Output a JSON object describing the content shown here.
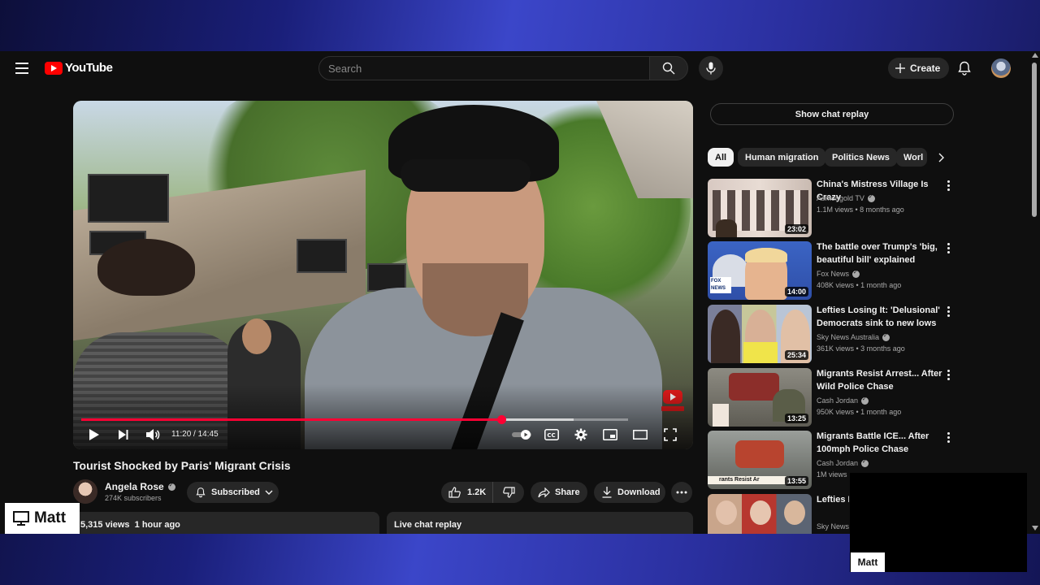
{
  "header": {
    "logo_text": "YouTube",
    "search_placeholder": "Search",
    "create_label": "Create"
  },
  "player": {
    "time_display": "11:20 / 14:45",
    "progress_fraction": 0.768,
    "loaded_fraction": 0.9
  },
  "video": {
    "title": "Tourist Shocked by Paris' Migrant Crisis",
    "channel_name": "Angela Rose",
    "subscribers": "274K subscribers",
    "subscribed_label": "Subscribed",
    "like_count": "1.2K",
    "share_label": "Share",
    "download_label": "Download",
    "views_time": "5,315 views  1 hour ago",
    "live_chat_replay": "Live chat replay"
  },
  "sidebar": {
    "show_chat_replay": "Show chat replay",
    "chips": [
      "All",
      "Human migration",
      "Politics News",
      "Worl"
    ],
    "recommendations": [
      {
        "title": "China's Mistress Village Is Crazy",
        "channel": "Asmongold TV",
        "verified": true,
        "meta": "1.1M views • 8 months ago",
        "duration": "23:02"
      },
      {
        "title": "The battle over Trump's 'big, beautiful bill' explained",
        "channel": "Fox News",
        "verified": true,
        "meta": "408K views • 1 month ago",
        "duration": "14:00"
      },
      {
        "title": "Lefties Losing It: 'Delusional' Democrats sink to new lows",
        "channel": "Sky News Australia",
        "verified": true,
        "meta": "361K views • 3 months ago",
        "duration": "25:34"
      },
      {
        "title": "Migrants Resist Arrest... After Wild Police Chase",
        "channel": "Cash Jordan",
        "verified": true,
        "meta": "950K views • 1 month ago",
        "duration": "13:25"
      },
      {
        "title": "Migrants Battle ICE... After 100mph Police Chase",
        "channel": "Cash Jordan",
        "verified": true,
        "meta": "1M views",
        "duration": "13:55"
      },
      {
        "title": "Lefties L... Secretar...",
        "channel": "Sky News",
        "verified": false,
        "meta": "",
        "duration": ""
      }
    ]
  },
  "thumb_text": {
    "fox": "FOX NEWS",
    "migrants_banner": "rants Resist Ar"
  },
  "overlays": {
    "presenter_left": "Matt",
    "presenter_right": "Matt"
  },
  "colors": {
    "accent_red": "#ff0033",
    "background": "#0f0f0f",
    "chip_bg": "#272727"
  }
}
